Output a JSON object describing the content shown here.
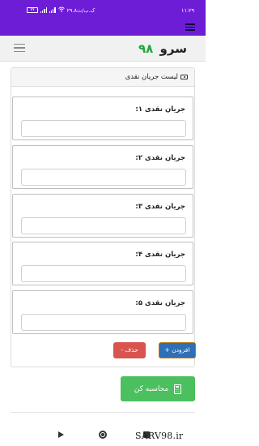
{
  "status_bar": {
    "time": "۱۱:۲۹",
    "network_speed": "۲۹.۸ک.ب/ث",
    "battery": "۷۷"
  },
  "header": {
    "brand_name": "سرو",
    "brand_number": "۹۸"
  },
  "panel": {
    "title": "لیست جریان نقدی",
    "fields": [
      {
        "label": "جریان نقدی ۱:",
        "value": ""
      },
      {
        "label": "جریان نقدی ۲:",
        "value": ""
      },
      {
        "label": "جریان نقدی ۳:",
        "value": ""
      },
      {
        "label": "جریان نقدی ۴:",
        "value": ""
      },
      {
        "label": "جریان نقدی ۵:",
        "value": ""
      }
    ],
    "add_button": "+ افزودن",
    "delete_button": "- حذف"
  },
  "calculate_button": "محاسبه کن",
  "watermark": "SARV98.ir",
  "colors": {
    "status_bar": "#6d1dd6",
    "brand_number": "#1fa63c",
    "add_button": "#2e6fb5",
    "delete_button": "#d9534f",
    "calculate_button": "#4cbf5e"
  },
  "icons": {
    "header_menu": "hamburger-icon",
    "panel_title": "money-bill-icon",
    "calculate": "calculator-icon"
  }
}
